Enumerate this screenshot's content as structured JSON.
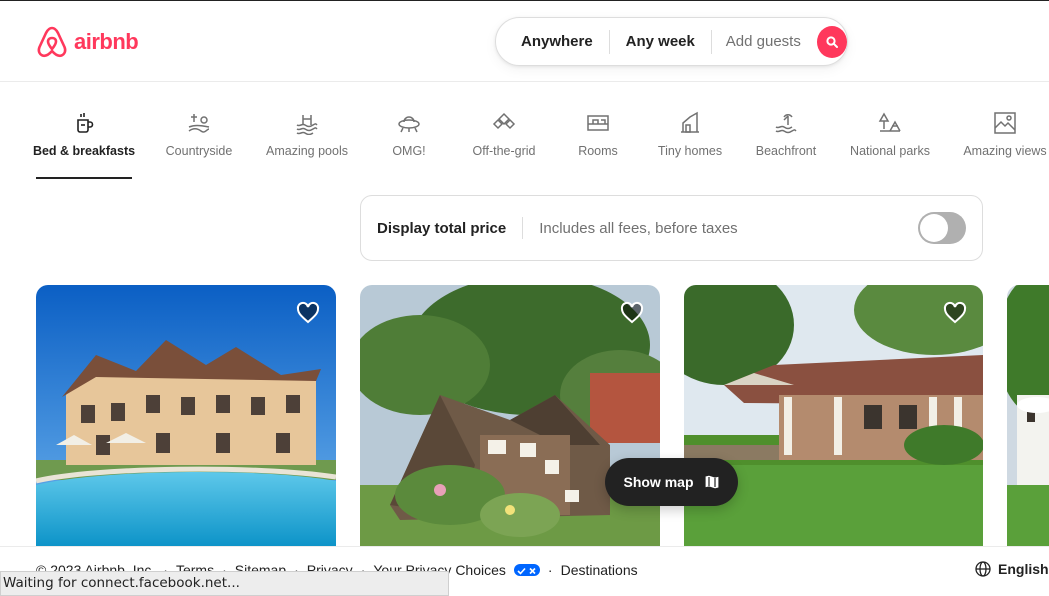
{
  "brand": {
    "name": "airbnb",
    "color": "#ff385c"
  },
  "search": {
    "where": "Anywhere",
    "when": "Any week",
    "who": "Add guests",
    "button_icon": "search-icon"
  },
  "categories": [
    {
      "label": "Bed & breakfasts",
      "icon": "coffee-icon",
      "active": true
    },
    {
      "label": "Countryside",
      "icon": "countryside-icon"
    },
    {
      "label": "Amazing pools",
      "icon": "pool-icon"
    },
    {
      "label": "OMG!",
      "icon": "ufo-icon"
    },
    {
      "label": "Off-the-grid",
      "icon": "off-grid-icon"
    },
    {
      "label": "Rooms",
      "icon": "rooms-icon"
    },
    {
      "label": "Tiny homes",
      "icon": "tiny-home-icon"
    },
    {
      "label": "Beachfront",
      "icon": "beach-icon"
    },
    {
      "label": "National parks",
      "icon": "national-park-icon"
    },
    {
      "label": "Amazing views",
      "icon": "views-icon"
    }
  ],
  "price_toggle": {
    "title": "Display total price",
    "subtitle": "Includes all fees, before taxes",
    "enabled": false
  },
  "map_button": {
    "label": "Show map",
    "icon": "map-icon"
  },
  "footer": {
    "copyright": "© 2023 Airbnb, Inc.",
    "terms": "Terms",
    "sitemap": "Sitemap",
    "privacy": "Privacy",
    "privacy_choices": "Your Privacy Choices",
    "destinations": "Destinations",
    "language": "English"
  },
  "status": "Waiting for connect.facebook.net..."
}
